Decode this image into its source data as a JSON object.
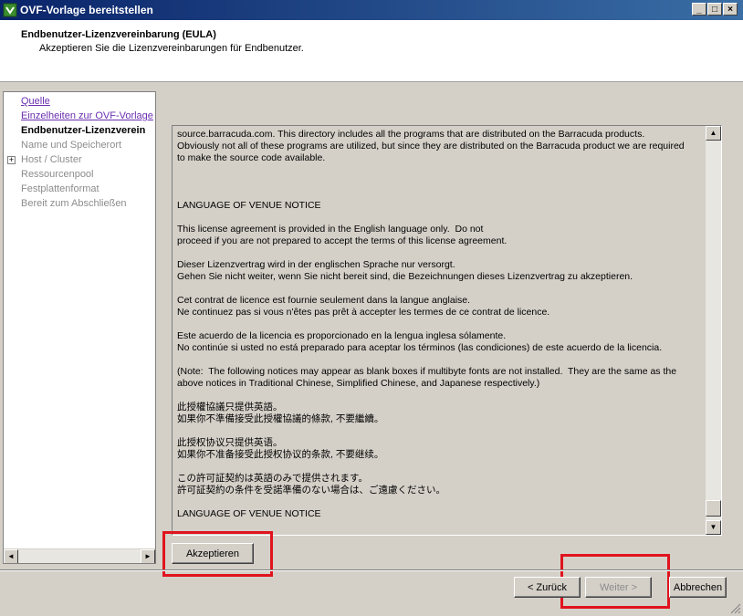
{
  "window": {
    "title": "OVF-Vorlage bereitstellen",
    "minimize_glyph": "_",
    "maximize_glyph": "□",
    "close_glyph": "×"
  },
  "header": {
    "title": "Endbenutzer-Lizenzvereinbarung (EULA)",
    "subtitle": "Akzeptieren Sie die Lizenzvereinbarungen für Endbenutzer."
  },
  "nav": {
    "items": [
      {
        "label": "Quelle",
        "state": "link"
      },
      {
        "label": "Einzelheiten zur OVF-Vorlage",
        "state": "link"
      },
      {
        "label": "Endbenutzer-Lizenzverein",
        "state": "current"
      },
      {
        "label": "Name und Speicherort",
        "state": "disabled"
      },
      {
        "label": "Host / Cluster",
        "state": "disabled",
        "expandable": true
      },
      {
        "label": "Ressourcenpool",
        "state": "disabled"
      },
      {
        "label": "Festplattenformat",
        "state": "disabled"
      },
      {
        "label": "Bereit zum Abschließen",
        "state": "disabled"
      }
    ],
    "expander_glyph": "+"
  },
  "eula": {
    "text": "source.barracuda.com. This directory includes all the programs that are distributed on the Barracuda products.\nObviously not all of these programs are utilized, but since they are distributed on the Barracuda product we are required\nto make the source code available.\n\n\n\nLANGUAGE OF VENUE NOTICE\n\nThis license agreement is provided in the English language only.  Do not\nproceed if you are not prepared to accept the terms of this license agreement.\n\nDieser Lizenzvertrag wird in der englischen Sprache nur versorgt.\nGehen Sie nicht weiter, wenn Sie nicht bereit sind, die Bezeichnungen dieses Lizenzvertrag zu akzeptieren.\n\nCet contrat de licence est fournie seulement dans la langue anglaise.\nNe continuez pas si vous n'êtes pas prêt à accepter les termes de ce contrat de licence.\n\nEste acuerdo de la licencia es proporcionado en la lengua inglesa sólamente.\nNo continúe si usted no está preparado para aceptar los términos (las condiciones) de este acuerdo de la licencia.\n\n(Note:  The following notices may appear as blank boxes if multibyte fonts are not installed.  They are the same as the\nabove notices in Traditional Chinese, Simplified Chinese, and Japanese respectively.)\n\n此授權協議只提供英語。\n如果你不準備接受此授權協議的條款, 不要繼續。\n\n此授权协议只提供英语。\n如果你不准备接受此授权协议的条款, 不要继续。\n\nこの許可証契約は英語のみで提供されます。\n許可証契約の条件を受諾準備のない場合は、ご遠慮ください。\n\nLANGUAGE OF VENUE NOTICE"
  },
  "buttons": {
    "accept": "Akzeptieren",
    "back": "< Zurück",
    "next": "Weiter >",
    "cancel": "Abbrechen"
  },
  "scroll_glyphs": {
    "up": "▲",
    "down": "▼",
    "left": "◄",
    "right": "►"
  },
  "colors": {
    "highlight_box": "#e0141e",
    "visited_link": "#6a2fb0"
  }
}
